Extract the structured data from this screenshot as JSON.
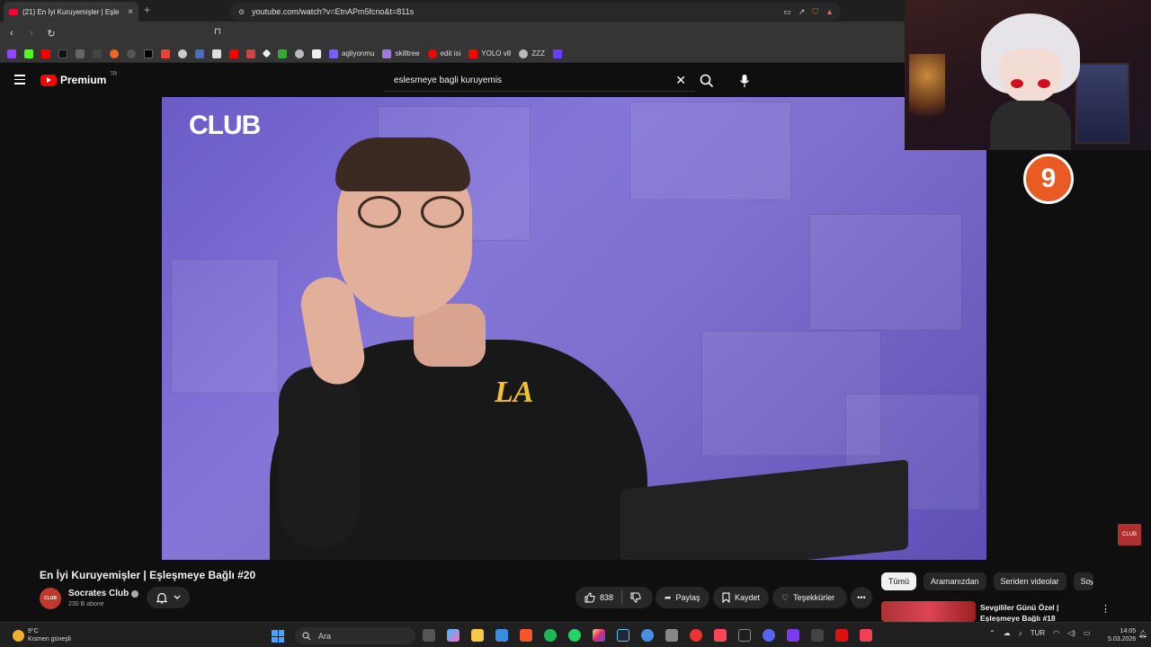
{
  "browser": {
    "tab_title": "(21) En İyi Kuruyemişler | Eşle",
    "tab_close": "×",
    "new_tab": "+",
    "url": "youtube.com/watch?v=EtnAPm5fcno&t=811s",
    "bookmarks": [
      {
        "label": "agliyonmu",
        "color": "#7b5cff"
      },
      {
        "label": "skilltree",
        "color": "#9c7bd6"
      },
      {
        "label": "edit isi",
        "color": "#ff0000"
      },
      {
        "label": "YOLO v8",
        "color": "#ff0000"
      },
      {
        "label": "ZZZ",
        "color": "#bbbbbb"
      }
    ]
  },
  "youtube": {
    "logo_text": "Premium",
    "region": "TR",
    "search_query": "eslesmeye bagli kuruyemis",
    "video_overlay_brand": "CLUB",
    "corner_watermark": "CLUB"
  },
  "video": {
    "title": "En İyi Kuruyemişler | Eşleşmeye Bağlı #20",
    "channel_avatar_text": "CLUB",
    "channel_name": "Socrates Club",
    "subscribers": "230 B abone",
    "likes": "838",
    "share_label": "Paylaş",
    "save_label": "Kaydet",
    "thanks_label": "Teşekkürler",
    "more_label": "•••"
  },
  "sidebar": {
    "chips": [
      "Tümü",
      "Aramanızdan",
      "Seriden videolar",
      "So"
    ],
    "recommendation_title": "Sevgililer Günü Özel | Eşleşmeye Bağlı #18"
  },
  "sticker_text": "9",
  "taskbar": {
    "temperature": "9°C",
    "weather_desc": "Kısmen güneşli",
    "search_placeholder": "Ara",
    "language": "TUR",
    "time": "14:05",
    "date": "5.03.2026"
  }
}
